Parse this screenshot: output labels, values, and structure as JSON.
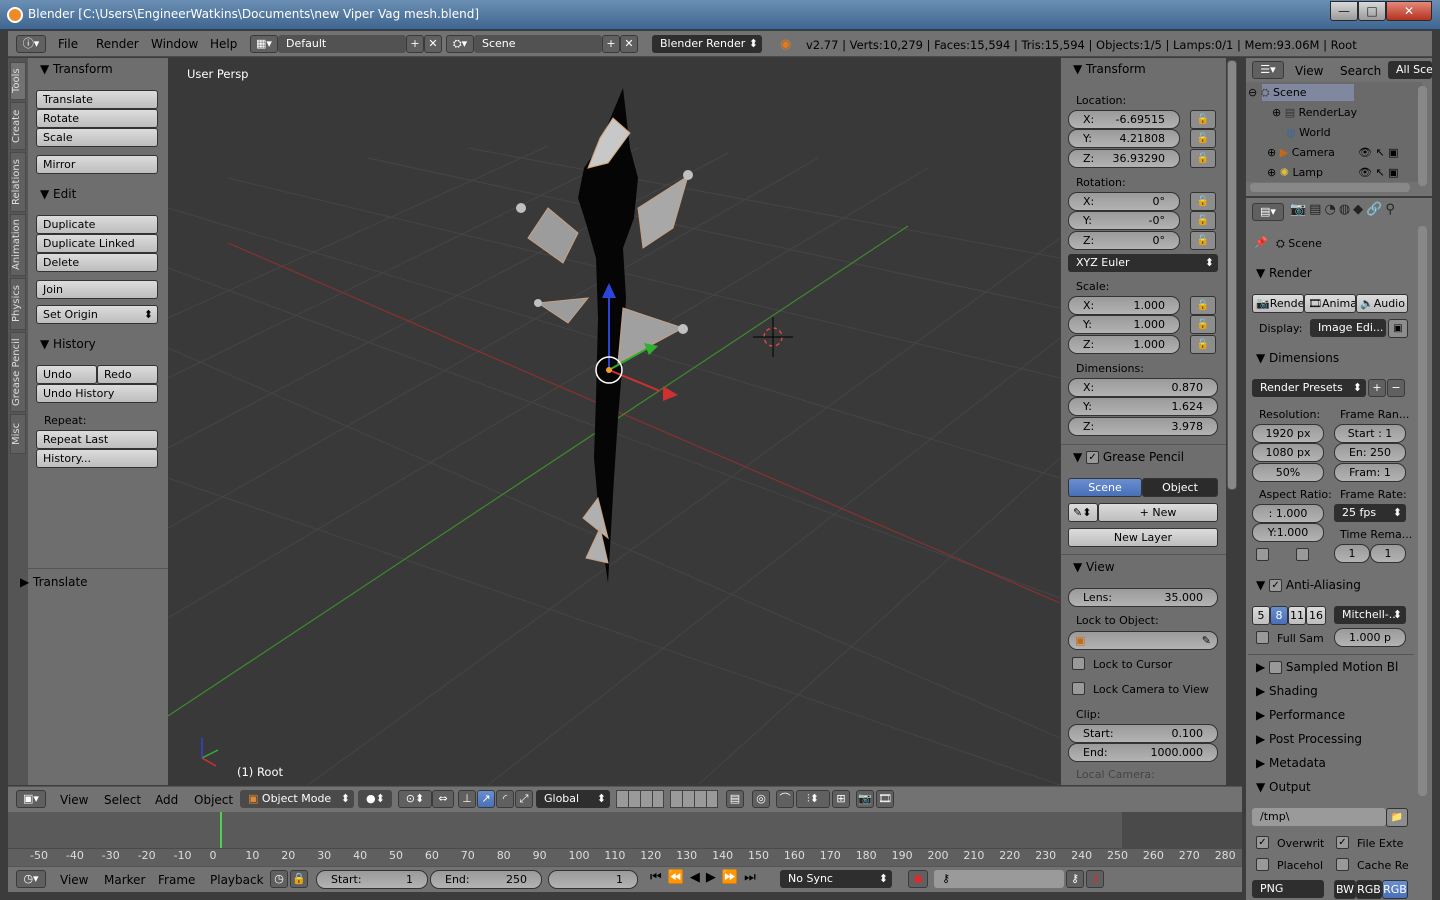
{
  "window": {
    "title": "Blender [C:\\Users\\EngineerWatkins\\Documents\\new Viper Vag mesh.blend]",
    "min": "—",
    "max": "□",
    "close": "✕"
  },
  "infobar": {
    "menus": [
      "File",
      "Render",
      "Window",
      "Help"
    ],
    "layout": "Default",
    "scene": "Scene",
    "engine": "Blender Render",
    "stats": "v2.77 | Verts:10,279 | Faces:15,594 | Tris:15,594 | Objects:1/5 | Lamps:0/1 | Mem:93.06M | Root"
  },
  "toolshelf": {
    "tabs": [
      "Tools",
      "Create",
      "Relations",
      "Animation",
      "Physics",
      "Grease Pencil",
      "Misc"
    ],
    "transform": {
      "title": "Transform",
      "translate": "Translate",
      "rotate": "Rotate",
      "scale": "Scale",
      "mirror": "Mirror"
    },
    "edit": {
      "title": "Edit",
      "duplicate": "Duplicate",
      "duplicate_linked": "Duplicate Linked",
      "delete": "Delete",
      "join": "Join",
      "set_origin": "Set Origin"
    },
    "history": {
      "title": "History",
      "undo": "Undo",
      "redo": "Redo",
      "undo_history": "Undo History",
      "repeat_label": "Repeat:",
      "repeat_last": "Repeat Last",
      "history": "History..."
    },
    "operator": "Translate"
  },
  "viewport": {
    "persp": "User Persp",
    "object": "(1) Root"
  },
  "properties_n": {
    "transform_title": "Transform",
    "location_label": "Location:",
    "location": {
      "x": "-6.69515",
      "y": "4.21808",
      "z": "36.93290"
    },
    "rotation_label": "Rotation:",
    "rotation": {
      "x": "0°",
      "y": "-0°",
      "z": "0°"
    },
    "rotation_mode": "XYZ Euler",
    "scale_label": "Scale:",
    "scale": {
      "x": "1.000",
      "y": "1.000",
      "z": "1.000"
    },
    "dimensions_label": "Dimensions:",
    "dimensions": {
      "x": "0.870",
      "y": "1.624",
      "z": "3.978"
    },
    "axis": {
      "x": "X:",
      "y": "Y:",
      "z": "Z:"
    },
    "grease_pencil": {
      "title": "Grease Pencil",
      "scene": "Scene",
      "object": "Object",
      "new": "New",
      "new_layer": "New Layer"
    },
    "view": {
      "title": "View",
      "lens_label": "Lens:",
      "lens": "35.000",
      "lock_object": "Lock to Object:",
      "lock_cursor": "Lock to Cursor",
      "lock_camera": "Lock Camera to View",
      "clip": "Clip:",
      "start_label": "Start:",
      "clip_start": "0.100",
      "end_label": "End:",
      "clip_end": "1000.000",
      "local_camera": "Local Camera:"
    }
  },
  "outliner": {
    "menus": [
      "View",
      "Search"
    ],
    "filter": "All Scen",
    "items": [
      "Scene",
      "RenderLay",
      "World",
      "Camera",
      "Lamp"
    ]
  },
  "properties": {
    "context": "Scene",
    "render_title": "Render",
    "render_buttons": [
      "Rende",
      "Anima",
      "Audio"
    ],
    "display_label": "Display:",
    "display": "Image Edi...",
    "dimensions_title": "Dimensions",
    "render_presets": "Render Presets",
    "resolution_label": "Resolution:",
    "res_x": "1920 px",
    "res_y": "1080 px",
    "res_pct": "50%",
    "frame_range_label": "Frame Ran...",
    "frame_start": "Start : 1",
    "frame_end": "En: 250",
    "frame_step": "Fram: 1",
    "aspect_label": "Aspect Ratio:",
    "aspect_x": ": 1.000",
    "aspect_y": "Y:1.000",
    "frame_rate_label": "Frame Rate:",
    "fps": "25 fps",
    "time_remap_label": "Time Rema...",
    "remap_old": "1",
    "remap_new": "1",
    "aa_title": "Anti-Aliasing",
    "aa_samples": [
      "5",
      "8",
      "11",
      "16"
    ],
    "aa_filter": "Mitchell-...",
    "full_sample": "Full Sam",
    "filter_size": "1.000 p",
    "motion_blur": "Sampled Motion Bl",
    "shading": "Shading",
    "performance": "Performance",
    "post_processing": "Post Processing",
    "metadata": "Metadata",
    "output_title": "Output",
    "output_path": "/tmp\\",
    "overwrite": "Overwrit",
    "file_ext": "File Exte",
    "placeholder": "Placehol",
    "cache": "Cache Re",
    "format": "PNG",
    "color_modes": [
      "BW",
      "RGB",
      "RGB"
    ]
  },
  "view3d_header": {
    "menus": [
      "View",
      "Select",
      "Add",
      "Object"
    ],
    "mode": "Object Mode",
    "orientation": "Global"
  },
  "timeline": {
    "ruler": [
      "-50",
      "-40",
      "-30",
      "-20",
      "-10",
      "0",
      "10",
      "20",
      "30",
      "40",
      "50",
      "60",
      "70",
      "80",
      "90",
      "100",
      "110",
      "120",
      "130",
      "140",
      "150",
      "160",
      "170",
      "180",
      "190",
      "200",
      "210",
      "220",
      "230",
      "240",
      "250",
      "260",
      "270",
      "280"
    ],
    "menus": [
      "View",
      "Marker",
      "Frame",
      "Playback"
    ],
    "start_label": "Start:",
    "start": "1",
    "end_label": "End:",
    "end": "250",
    "current": "1",
    "sync": "No Sync"
  }
}
